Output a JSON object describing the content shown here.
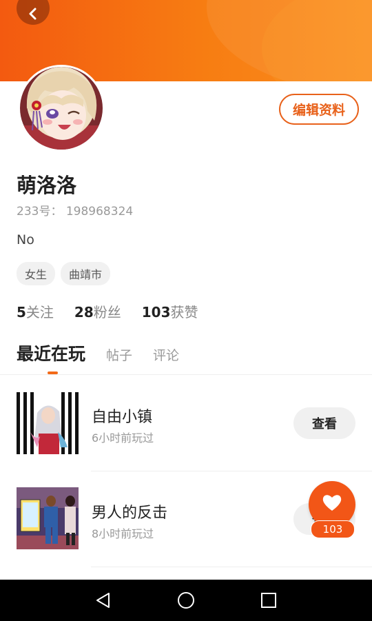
{
  "colors": {
    "accent": "#f35a10",
    "header_gradient": [
      "#f35a10",
      "#fb8d1e"
    ]
  },
  "header": {
    "back_icon": "chevron-left-icon"
  },
  "profile": {
    "edit_button": "编辑资料",
    "name": "萌洛洛",
    "id_text": "233号： 198968324",
    "bio": "No",
    "tags": [
      "女生",
      "曲靖市"
    ]
  },
  "stats": [
    {
      "num": "5",
      "label": "关注"
    },
    {
      "num": "28",
      "label": "粉丝"
    },
    {
      "num": "103",
      "label": "获赞"
    }
  ],
  "tabs": [
    {
      "label": "最近在玩",
      "active": true
    },
    {
      "label": "帖子",
      "active": false
    },
    {
      "label": "评论",
      "active": false
    }
  ],
  "games": [
    {
      "title": "自由小镇",
      "subtitle": "6小时前玩过",
      "button": "查看"
    },
    {
      "title": "男人的反击",
      "subtitle": "8小时前玩过",
      "button": "查看"
    }
  ],
  "like": {
    "icon": "heart-icon",
    "count": "103"
  },
  "navbar": {
    "icons": [
      "back-triangle-icon",
      "home-circle-icon",
      "recents-square-icon"
    ]
  }
}
